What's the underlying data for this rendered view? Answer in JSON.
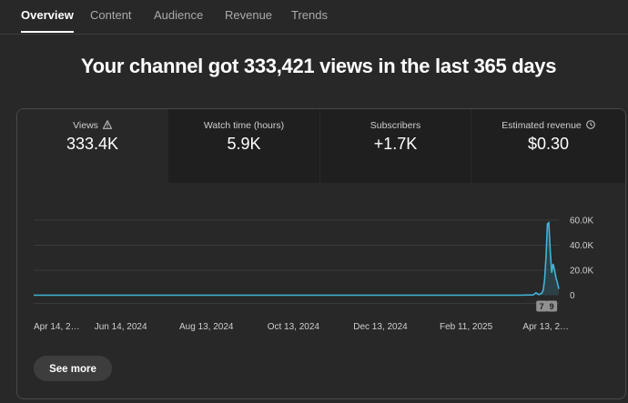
{
  "tabs": [
    {
      "label": "Overview",
      "active": true
    },
    {
      "label": "Content",
      "active": false
    },
    {
      "label": "Audience",
      "active": false
    },
    {
      "label": "Revenue",
      "active": false
    },
    {
      "label": "Trends",
      "active": false
    }
  ],
  "headline": "Your channel got 333,421 views in the last 365 days",
  "metrics": [
    {
      "label": "Views",
      "value": "333.4K",
      "icon": "warning-icon"
    },
    {
      "label": "Watch time (hours)",
      "value": "5.9K"
    },
    {
      "label": "Subscribers",
      "value": "+1.7K"
    },
    {
      "label": "Estimated revenue",
      "value": "$0.30",
      "icon": "clock-icon"
    }
  ],
  "see_more_label": "See more",
  "colors": {
    "line": "#41b4d8",
    "background": "#282828",
    "inactive_tab": "#1f1f1f"
  },
  "chart_data": {
    "type": "area",
    "series_metric": "Views",
    "y_ticks": [
      "60.0K",
      "40.0K",
      "20.0K",
      "0"
    ],
    "y_tick_values": [
      60000,
      40000,
      20000,
      0
    ],
    "ylim": [
      0,
      60000
    ],
    "x_tick_labels": [
      "Apr 14, 2…",
      "Jun 14, 2024",
      "Aug 13, 2024",
      "Oct 13, 2024",
      "Dec 13, 2024",
      "Feb 11, 2025",
      "Apr 13, 2…"
    ],
    "x_tick_days": [
      0,
      61,
      121,
      182,
      243,
      303,
      364
    ],
    "points": [
      {
        "day": 0,
        "value": 0
      },
      {
        "day": 340,
        "value": 0
      },
      {
        "day": 350,
        "value": 200
      },
      {
        "day": 352,
        "value": 2000
      },
      {
        "day": 354,
        "value": 500
      },
      {
        "day": 356,
        "value": 1500
      },
      {
        "day": 357,
        "value": 4000
      },
      {
        "day": 358,
        "value": 12000
      },
      {
        "day": 359,
        "value": 30000
      },
      {
        "day": 360,
        "value": 57000
      },
      {
        "day": 361,
        "value": 58000
      },
      {
        "day": 362,
        "value": 35000
      },
      {
        "day": 363,
        "value": 18000
      },
      {
        "day": 364,
        "value": 25000
      },
      {
        "day": 365,
        "value": 20000
      },
      {
        "day": 366,
        "value": 14000
      },
      {
        "day": 367,
        "value": 10000
      },
      {
        "day": 368,
        "value": 5000
      }
    ],
    "annotations": [
      {
        "label": "7",
        "day": 356
      },
      {
        "label": "9",
        "day": 363
      }
    ],
    "grid": true
  }
}
